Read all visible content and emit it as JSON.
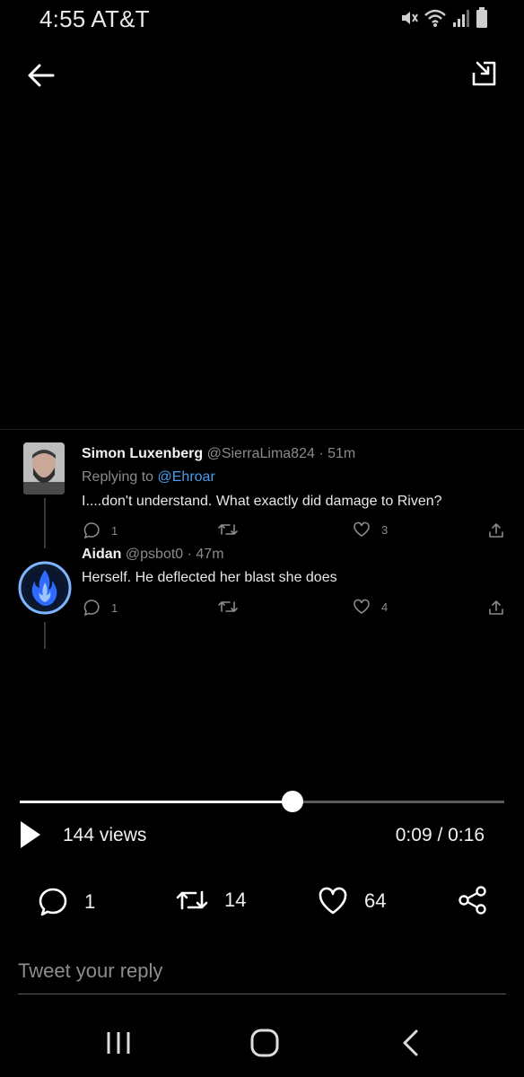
{
  "status_bar": {
    "time": "4:55",
    "carrier": "AT&T",
    "icons": [
      "mute-icon",
      "wifi-icon",
      "signal-icon",
      "battery-icon"
    ]
  },
  "top_nav": {
    "back_icon": "arrow-left-icon",
    "expand_icon": "picture-in-picture-icon"
  },
  "embedded_tweets": [
    {
      "name": "Simon Luxenberg",
      "handle": "@SierraLima824 · 51m",
      "replying_label": "Replying to ",
      "replying_to": "@Ehroar",
      "text": "I....don't understand. What exactly did damage to Riven?",
      "replies": "1",
      "retweets": "",
      "likes": "3"
    },
    {
      "name": "Aidan",
      "handle": "@psbot0 · 47m",
      "text": "Herself. He deflected her blast she does",
      "replies": "1",
      "retweets": "",
      "likes": "4"
    }
  ],
  "player": {
    "progress": 0.563,
    "views": "144 views",
    "time": "0:09 / 0:16"
  },
  "engagement": {
    "replies": "1",
    "retweets": "14",
    "likes": "64"
  },
  "reply": {
    "placeholder": "Tweet your reply"
  },
  "colors": {
    "background": "#000000",
    "mention": "#4a9eeb",
    "muted": "#8a8a8a"
  }
}
